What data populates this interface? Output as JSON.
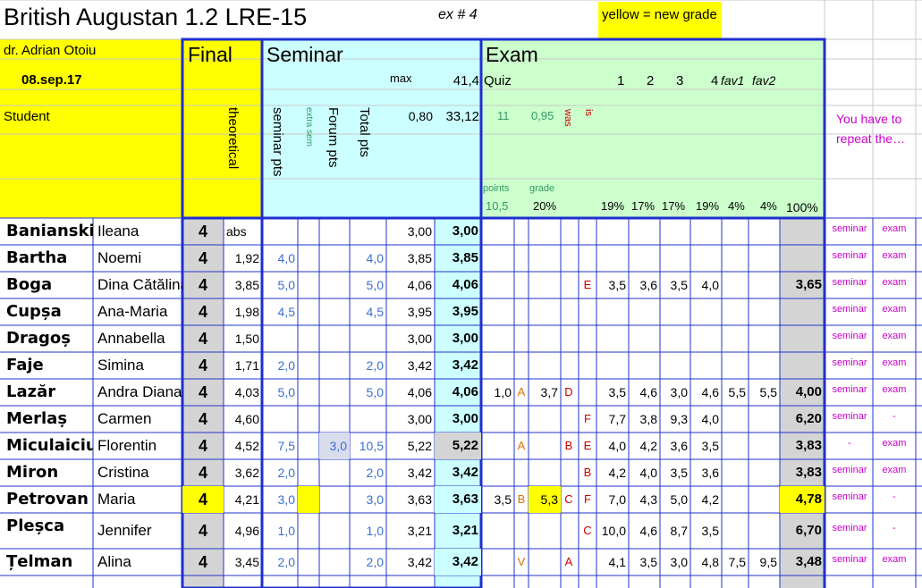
{
  "sheet": {
    "title": "British Augustan 1.2 LRE-15",
    "ex_label": "ex # 4",
    "legend": "yellow = new grade",
    "teacher": "dr. Adrian Otoiu",
    "date": "08.sep.17",
    "student_label": "Student"
  },
  "headers": {
    "final": "Final",
    "theoretical": "theoretical",
    "seminar": "Seminar",
    "seminar_pts": "seminar pts",
    "extra_sem": "extra sem",
    "forum_pts": "Forum pts",
    "total_pts": "Total pts",
    "max_label": "max",
    "max_value": "41,4",
    "row2_a": "0,80",
    "row2_b": "33,12",
    "exam": "Exam",
    "quiz": "Quiz",
    "quiz_11": "11",
    "quiz_095": "0,95",
    "was": "was",
    "is": "is",
    "cols": [
      "1",
      "2",
      "3",
      "4"
    ],
    "fav1": "fav1",
    "fav2": "fav2",
    "points_label": "points",
    "grade_label": "grade",
    "points_val": "10,5",
    "grade_val": "20%",
    "pcts": [
      "19%",
      "17%",
      "17%",
      "19%",
      "4%",
      "4%",
      "100%"
    ],
    "repeat_note": "You have to repeat the…"
  },
  "rows": [
    {
      "last": "Banianski",
      "first": "Ileana",
      "final": "4",
      "theo": "abs",
      "sem": "",
      "extra": "",
      "forum": "",
      "total": "",
      "s1": "3,00",
      "s2": "3,00",
      "q1": "",
      "qa": "",
      "q2": "",
      "qb": "",
      "was": "",
      "is": "",
      "e1": "",
      "e2": "",
      "e3": "",
      "e4": "",
      "f1": "",
      "f2": "",
      "eg": "",
      "rs": "seminar",
      "re": "exam"
    },
    {
      "last": "Bartha",
      "first": "Noemi",
      "final": "4",
      "theo": "1,92",
      "sem": "4,0",
      "extra": "",
      "forum": "",
      "total": "4,0",
      "s1": "3,85",
      "s2": "3,85",
      "q1": "",
      "qa": "",
      "q2": "",
      "qb": "",
      "was": "",
      "is": "",
      "e1": "",
      "e2": "",
      "e3": "",
      "e4": "",
      "f1": "",
      "f2": "",
      "eg": "",
      "rs": "seminar",
      "re": "exam"
    },
    {
      "last": "Boga",
      "first": "Dina Cătălina",
      "final": "4",
      "theo": "3,85",
      "sem": "5,0",
      "extra": "",
      "forum": "",
      "total": "5,0",
      "s1": "4,06",
      "s2": "4,06",
      "q1": "",
      "qa": "",
      "q2": "",
      "qb": "",
      "was": "",
      "is": "E",
      "e1": "3,5",
      "e2": "3,6",
      "e3": "3,5",
      "e4": "4,0",
      "f1": "",
      "f2": "",
      "eg": "3,65",
      "rs": "seminar",
      "re": "exam"
    },
    {
      "last": "Cupșa",
      "first": "Ana-Maria",
      "final": "4",
      "theo": "1,98",
      "sem": "4,5",
      "extra": "",
      "forum": "",
      "total": "4,5",
      "s1": "3,95",
      "s2": "3,95",
      "q1": "",
      "qa": "",
      "q2": "",
      "qb": "",
      "was": "",
      "is": "",
      "e1": "",
      "e2": "",
      "e3": "",
      "e4": "",
      "f1": "",
      "f2": "",
      "eg": "",
      "rs": "seminar",
      "re": "exam"
    },
    {
      "last": "Dragoș",
      "first": "Annabella",
      "final": "4",
      "theo": "1,50",
      "sem": "",
      "extra": "",
      "forum": "",
      "total": "",
      "s1": "3,00",
      "s2": "3,00",
      "q1": "",
      "qa": "",
      "q2": "",
      "qb": "",
      "was": "",
      "is": "",
      "e1": "",
      "e2": "",
      "e3": "",
      "e4": "",
      "f1": "",
      "f2": "",
      "eg": "",
      "rs": "seminar",
      "re": "exam"
    },
    {
      "last": "Faje",
      "first": "Simina",
      "final": "4",
      "theo": "1,71",
      "sem": "2,0",
      "extra": "",
      "forum": "",
      "total": "2,0",
      "s1": "3,42",
      "s2": "3,42",
      "q1": "",
      "qa": "",
      "q2": "",
      "qb": "",
      "was": "",
      "is": "",
      "e1": "",
      "e2": "",
      "e3": "",
      "e4": "",
      "f1": "",
      "f2": "",
      "eg": "",
      "rs": "seminar",
      "re": "exam"
    },
    {
      "last": "Lazăr",
      "first": "Andra Diana",
      "final": "4",
      "theo": "4,03",
      "sem": "5,0",
      "extra": "",
      "forum": "",
      "total": "5,0",
      "s1": "4,06",
      "s2": "4,06",
      "q1": "1,0",
      "qa": "A",
      "q2": "3,7",
      "qb": "D",
      "was": "",
      "is": "",
      "e1": "3,5",
      "e2": "4,6",
      "e3": "3,0",
      "e4": "4,6",
      "f1": "5,5",
      "f2": "5,5",
      "eg": "4,00",
      "rs": "seminar",
      "re": "exam"
    },
    {
      "last": "Merlaș",
      "first": "Carmen",
      "final": "4",
      "theo": "4,60",
      "sem": "",
      "extra": "",
      "forum": "",
      "total": "",
      "s1": "3,00",
      "s2": "3,00",
      "q1": "",
      "qa": "",
      "q2": "",
      "qb": "",
      "was": "",
      "is": "F",
      "e1": "7,7",
      "e2": "3,8",
      "e3": "9,3",
      "e4": "4,0",
      "f1": "",
      "f2": "",
      "eg": "6,20",
      "rs": "seminar",
      "re": "-"
    },
    {
      "last": "Miculaiciuc",
      "first": "Florentin",
      "final": "4",
      "theo": "4,52",
      "sem": "7,5",
      "extra": "",
      "forum": "3,0",
      "total": "10,5",
      "s1": "5,22",
      "s2": "5,22",
      "q1": "",
      "qa": "A",
      "q2": "",
      "qb": "B",
      "was": "",
      "is": "E",
      "e1": "4,0",
      "e2": "4,2",
      "e3": "3,6",
      "e4": "3,5",
      "f1": "",
      "f2": "",
      "eg": "3,83",
      "rs": "-",
      "re": "exam"
    },
    {
      "last": "Miron",
      "first": "Cristina",
      "final": "4",
      "theo": "3,62",
      "sem": "2,0",
      "extra": "",
      "forum": "",
      "total": "2,0",
      "s1": "3,42",
      "s2": "3,42",
      "q1": "",
      "qa": "",
      "q2": "",
      "qb": "",
      "was": "",
      "is": "B",
      "e1": "4,2",
      "e2": "4,0",
      "e3": "3,5",
      "e4": "3,6",
      "f1": "",
      "f2": "",
      "eg": "3,83",
      "rs": "seminar",
      "re": "exam"
    },
    {
      "last": "Petrovan",
      "first": "Maria",
      "final": "4",
      "theo": "4,21",
      "sem": "3,0",
      "extra": "",
      "forum": "",
      "total": "3,0",
      "s1": "3,63",
      "s2": "3,63",
      "q1": "3,5",
      "qa": "B",
      "q2": "5,3",
      "qb": "C",
      "was": "",
      "is": "F",
      "e1": "7,0",
      "e2": "4,3",
      "e3": "5,0",
      "e4": "4,2",
      "f1": "",
      "f2": "",
      "eg": "4,78",
      "rs": "seminar",
      "re": "-"
    },
    {
      "last": "Pleșca",
      "first": "Jennifer",
      "final": "4",
      "theo": "4,96",
      "sem": "1,0",
      "extra": "",
      "forum": "",
      "total": "1,0",
      "s1": "3,21",
      "s2": "3,21",
      "q1": "",
      "qa": "",
      "q2": "",
      "qb": "",
      "was": "",
      "is": "C",
      "e1": "10,0",
      "e2": "4,6",
      "e3": "8,7",
      "e4": "3,5",
      "f1": "",
      "f2": "",
      "eg": "6,70",
      "rs": "seminar",
      "re": "-"
    },
    {
      "last": "Țelman",
      "first": "Alina",
      "final": "4",
      "theo": "3,45",
      "sem": "2,0",
      "extra": "",
      "forum": "",
      "total": "2,0",
      "s1": "3,42",
      "s2": "3,42",
      "q1": "",
      "qa": "V",
      "q2": "",
      "qb": "",
      "was": "A",
      "is": "",
      "e1": "4,1",
      "e2": "3,5",
      "e3": "3,0",
      "e4": "4,8",
      "f1": "7,5",
      "f2": "9,5",
      "eg": "3,48",
      "rs": "seminar",
      "re": "exam"
    }
  ],
  "colors": {
    "yellow": "#ffff00",
    "cyan": "#ccffff",
    "green": "#ccffcc",
    "gray": "#d4d4d4",
    "border_blue": "#1f2fd0",
    "magenta": "#cc00cc",
    "red": "#cc0000",
    "orange": "#e07000",
    "teal_green": "#339966"
  }
}
